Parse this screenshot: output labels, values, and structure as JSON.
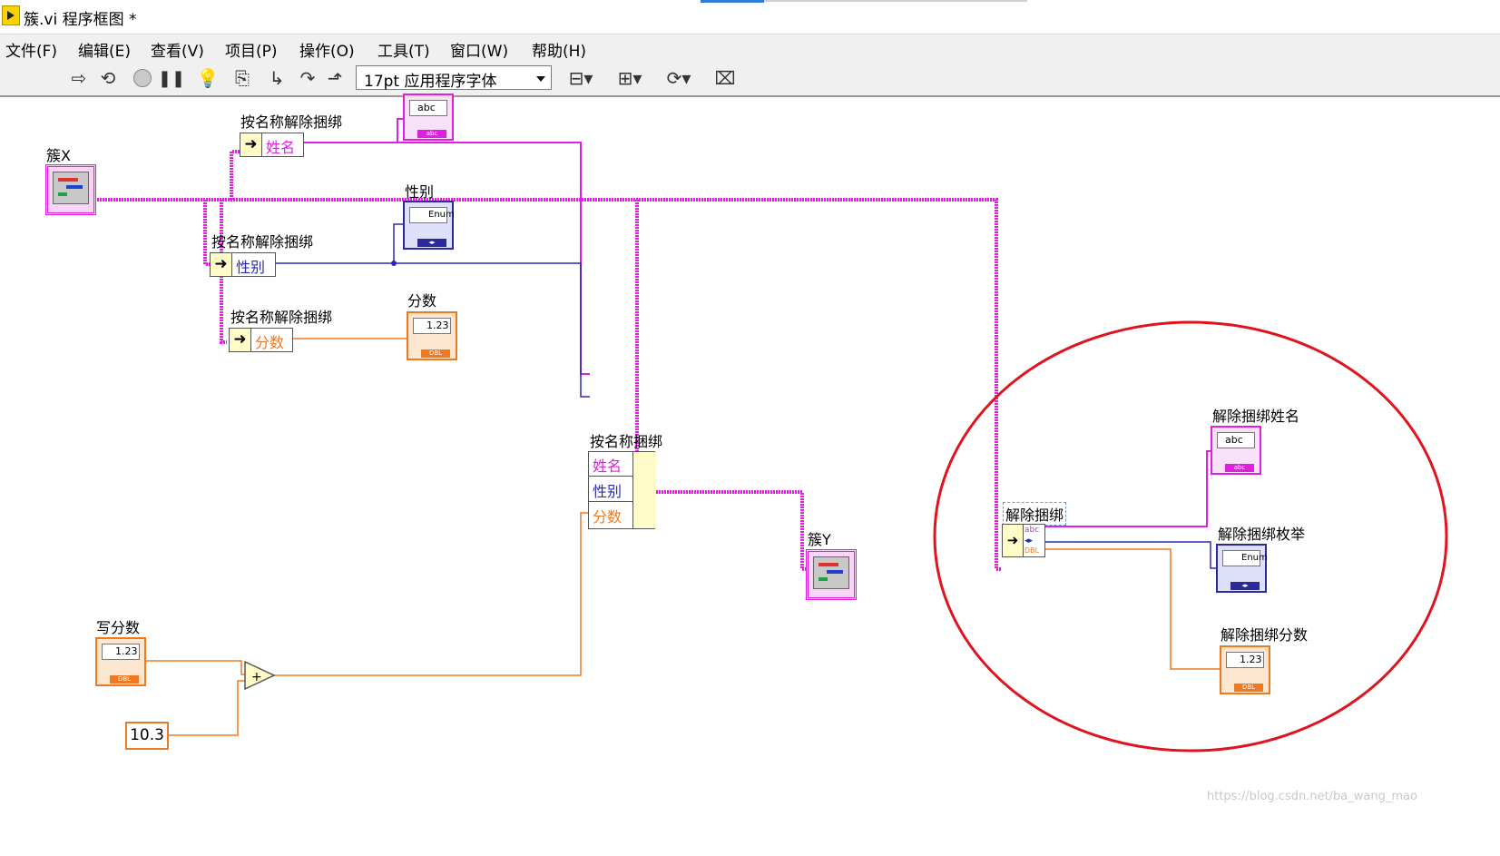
{
  "window": {
    "title": "簇.vi 程序框图 *"
  },
  "menu": [
    "文件(F)",
    "编辑(E)",
    "查看(V)",
    "项目(P)",
    "操作(O)",
    "工具(T)",
    "窗口(W)",
    "帮助(H)"
  ],
  "toolbar": {
    "icons": [
      "run-arrow-icon",
      "run-continuous-icon",
      "abort-icon",
      "pause-icon",
      "highlight-execution-icon",
      "retain-wire-values-icon",
      "step-into-icon",
      "step-over-icon",
      "step-out-icon",
      "align-objects-icon",
      "distribute-objects-icon",
      "reorder-icon",
      "cleanup-diagram-icon"
    ],
    "font_select": "17pt 应用程序字体"
  },
  "diagram": {
    "cluster_x_label": "簇X",
    "ubn1_label": "按名称解除捆绑",
    "ubn1_field": "姓名",
    "ubn2_label": "按名称解除捆绑",
    "ubn2_field": "性别",
    "ubn3_label": "按名称解除捆绑",
    "ubn3_field": "分数",
    "ind_gender_label": "性别",
    "ind_score_label": "分数",
    "bundle_label": "按名称捆绑",
    "bundle_fields": [
      "姓名",
      "性别",
      "分数"
    ],
    "cluster_y_label": "簇Y",
    "write_score_label": "写分数",
    "const_value": "10.3",
    "unbundle_label": "解除捆绑",
    "out_name_label": "解除捆绑姓名",
    "out_enum_label": "解除捆绑枚举",
    "out_score_label": "解除捆绑分数",
    "abc_text": "abc",
    "enum_text": "Enum",
    "num_text": "1.23",
    "dbl_tag": "DBL"
  },
  "watermark": "https://blog.csdn.net/ba_wang_mao",
  "colors": {
    "string_wire": "#e020e0",
    "enum_wire": "#2a2ab0",
    "dbl_wire": "#f07820",
    "highlight_circle": "#e0141e"
  }
}
